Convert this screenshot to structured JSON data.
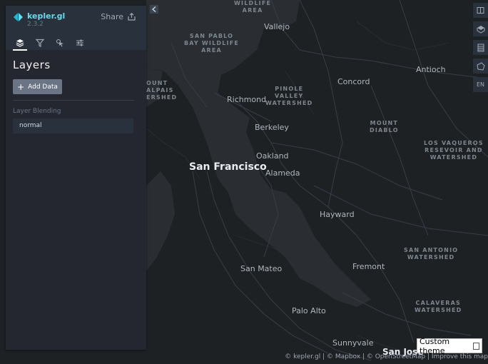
{
  "app": {
    "name": "kepler.gl",
    "version": "2.3.2",
    "share_label": "Share"
  },
  "panel": {
    "title": "Layers",
    "add_data_label": "Add Data",
    "layer_blending_label": "Layer Blending",
    "layer_blending_value": "normal"
  },
  "tabs": [
    "layers-icon",
    "filters-icon",
    "interactions-icon",
    "map-settings-icon"
  ],
  "toolbar": {
    "language": "EN"
  },
  "map_labels": {
    "wildlife": "WILDLIFE\nAREA",
    "vallejo": "Vallejo",
    "san_pablo": "SAN PABLO\nBAY WILDLIFE\nAREA",
    "antioch": "Antioch",
    "concord": "Concord",
    "tamalpais": "OUNT\nALPAIS\nERSHED",
    "richmond": "Richmond",
    "pinole": "PINOLE\nVALLEY\nWATERSHED",
    "berkeley": "Berkeley",
    "mount_diablo": "MOUNT\nDIABLO",
    "los_vaqueros": "LOS VAQUEROS\nRESEVOIR AND\nWATERSHED",
    "oakland": "Oakland",
    "san_francisco": "San Francisco",
    "alameda": "Alameda",
    "hayward": "Hayward",
    "san_antonio": "SAN ANTONIO\nWATERSHED",
    "san_mateo": "San Mateo",
    "fremont": "Fremont",
    "palo_alto": "Palo Alto",
    "calaveras": "CALAVERAS\nWATERSHED",
    "sunnyvale": "Sunnyvale",
    "san_jose": "San Jose"
  },
  "attribution": {
    "text": "© kepler.gl | © Mapbox | © OpenStreetMap | ",
    "improve": "Improve this map"
  },
  "custom_theme": {
    "label": "Custom theme"
  },
  "colors": {
    "accent": "#6ad8e8",
    "panel": "#242730",
    "map_bg": "#1e2124",
    "water": "#2a2d31"
  }
}
